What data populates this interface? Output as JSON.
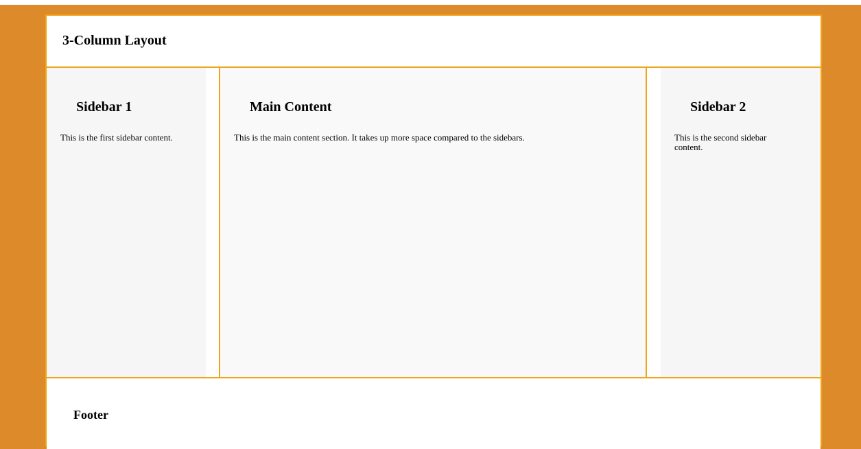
{
  "header": {
    "title": "3-Column Layout"
  },
  "sidebar1": {
    "title": "Sidebar 1",
    "text": "This is the first sidebar content."
  },
  "main": {
    "title": "Main Content",
    "text": "This is the main content section. It takes up more space compared to the sidebars."
  },
  "sidebar2": {
    "title": "Sidebar 2",
    "text": "This is the second sidebar content."
  },
  "footer": {
    "title": "Footer"
  },
  "colors": {
    "page_background": "#dd8a2b",
    "border": "#f0a418",
    "panel_background": "#f6f6f6",
    "main_background": "#f9f9f9"
  }
}
